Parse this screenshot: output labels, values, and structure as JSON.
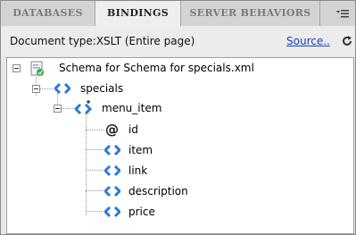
{
  "tabs": [
    {
      "label": "DATABASES"
    },
    {
      "label": "BINDINGS"
    },
    {
      "label": "SERVER BEHAVIORS"
    }
  ],
  "doc": {
    "type_label": "Document type:XSLT (Entire page)",
    "source_link": "Source.."
  },
  "tree": {
    "root": {
      "label": "Schema for Schema for specials.xml"
    },
    "specials": {
      "label": "specials"
    },
    "menu_item": {
      "label": "menu_item"
    },
    "children": [
      {
        "label": "id",
        "icon": "attribute-icon"
      },
      {
        "label": "item",
        "icon": "element-icon"
      },
      {
        "label": "link",
        "icon": "element-icon"
      },
      {
        "label": "description",
        "icon": "element-icon"
      },
      {
        "label": "price",
        "icon": "element-icon"
      }
    ]
  },
  "colors": {
    "link": "#1a3ec9",
    "element_icon": "#2c7bd6"
  }
}
